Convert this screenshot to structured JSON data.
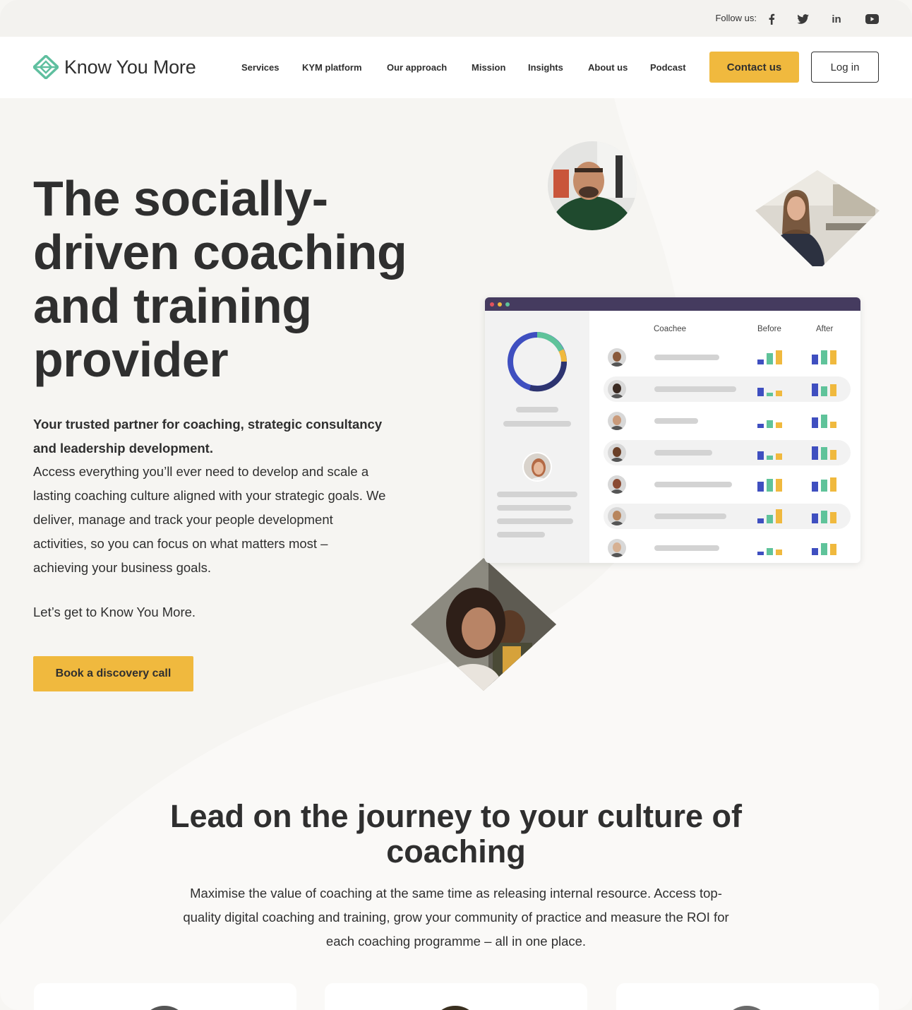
{
  "topbar": {
    "follow_label": "Follow us:",
    "social_icons": [
      "facebook-icon",
      "twitter-icon",
      "linkedin-icon",
      "youtube-icon"
    ]
  },
  "header": {
    "logo_text": "Know You More",
    "nav": [
      "Services",
      "KYM platform",
      "Our approach",
      "Mission",
      "Insights",
      "About us",
      "Podcast"
    ],
    "contact_label": "Contact us",
    "login_label": "Log in"
  },
  "hero": {
    "title": "The socially-driven coaching and training provider",
    "lead": "Your trusted partner for coaching, strategic consultancy and leadership development.",
    "body": "Access everything you’ll ever need to develop and scale a lasting coaching culture aligned with your strategic goals. We deliver, manage and track your people development activities, so you can focus on what matters most – achieving your business goals.",
    "tagline": "Let’s get to Know You More.",
    "cta_label": "Book a discovery call"
  },
  "dashboard": {
    "col_coachee": "Coachee",
    "col_before": "Before",
    "col_after": "After"
  },
  "section2": {
    "title": "Lead on the journey to your culture of coaching",
    "body": "Maximise the value of coaching at the same time as releasing internal resource. Access top-quality digital coaching and training, grow your community of practice and measure the ROI for each coaching programme – all in one place."
  },
  "colors": {
    "accent": "#f0b93e",
    "logo": "#5fbf9f",
    "text": "#2f2f2f",
    "bar_blue": "#3f4fc0",
    "bar_green": "#5fc39a",
    "bar_yellow": "#f0b93e",
    "dash_titlebar": "#453b5f"
  }
}
